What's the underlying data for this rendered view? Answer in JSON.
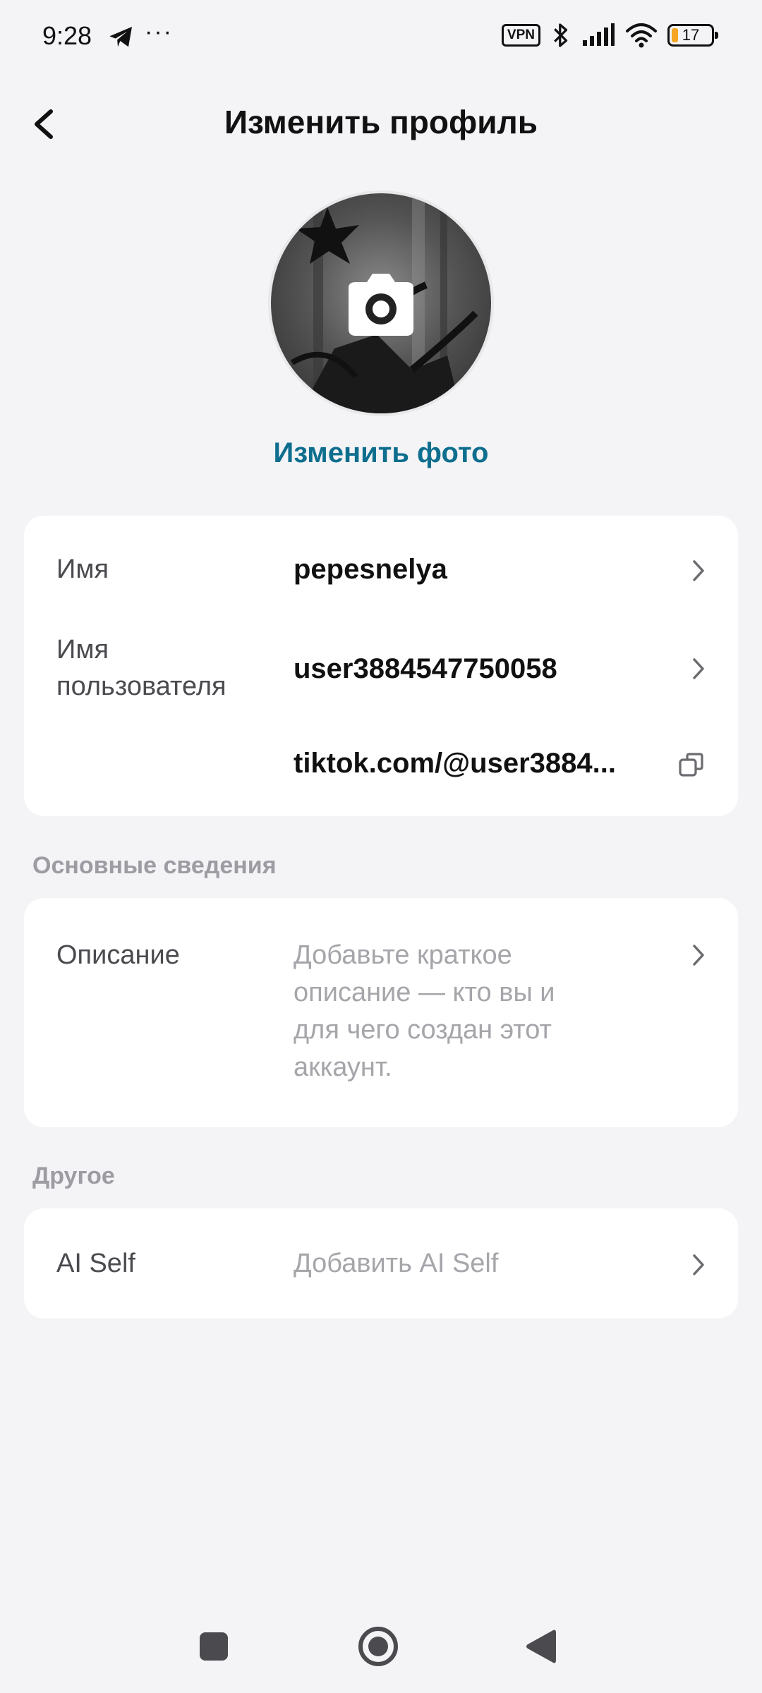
{
  "status_bar": {
    "time": "9:28",
    "more": "···",
    "vpn": "VPN",
    "battery": "17",
    "battery_color": "#f5a623",
    "icons": [
      "telegram-icon",
      "vpn-icon",
      "bluetooth-icon",
      "signal-icon",
      "wifi-icon",
      "battery-icon"
    ]
  },
  "header": {
    "title": "Изменить профиль",
    "back_icon": "back-arrow-icon"
  },
  "avatar": {
    "camera_icon": "camera-icon",
    "change_photo_label": "Изменить фото"
  },
  "profile_card": {
    "name_label": "Имя",
    "name_value": "pepesnelya",
    "username_label": "Имя\nпользователя",
    "username_value": "user3884547750058",
    "link_value": "tiktok.com/@user3884..."
  },
  "basic_section": {
    "title": "Основные сведения",
    "bio_label": "Описание",
    "bio_placeholder": "Добавьте краткое\nописание — кто вы и\nдля чего создан этот\nаккаунт."
  },
  "other_section": {
    "title": "Другое",
    "ai_label": "AI Self",
    "ai_placeholder": "Добавить AI Self"
  },
  "colors": {
    "accent": "#0e6e8e",
    "background": "#f4f3f6",
    "card": "#ffffff",
    "placeholder": "#a5a5aa"
  },
  "nav_bar": {
    "icons": [
      "recents-icon",
      "home-icon",
      "back-icon"
    ]
  }
}
